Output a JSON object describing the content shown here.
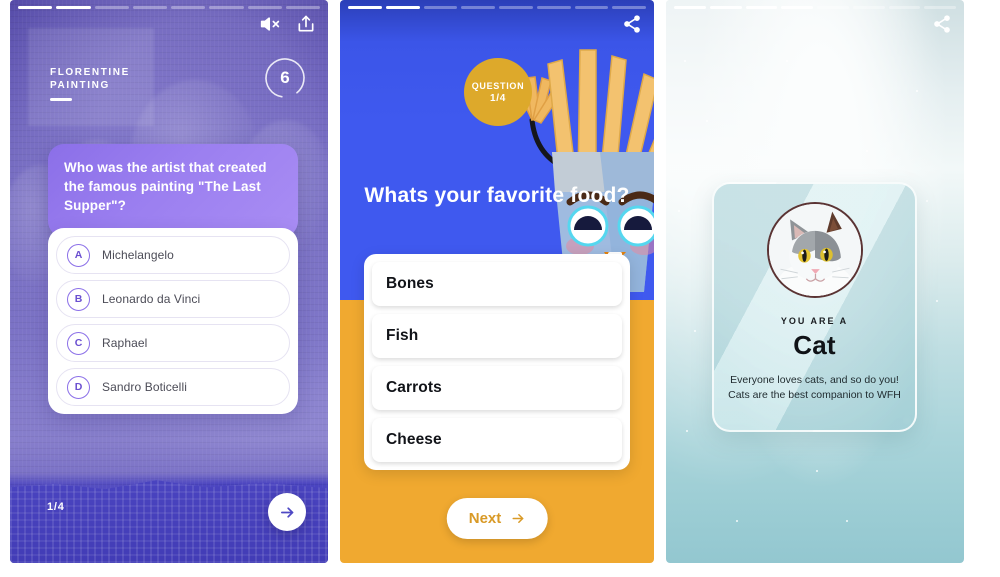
{
  "panels": [
    {
      "name": "quiz-question-purple",
      "progress": {
        "total": 8,
        "filled": 2
      },
      "icons": {
        "mute": "mute-icon",
        "share": "share-ios-icon"
      },
      "category": "FLORENTINE\nPAINTING",
      "category_line1": "FLORENTINE",
      "category_line2": "PAINTING",
      "timer": "6",
      "question": "Who was the artist that created the famous painting \"The Last Supper\"?",
      "answers": [
        {
          "letter": "A",
          "label": "Michelangelo"
        },
        {
          "letter": "B",
          "label": "Leonardo da Vinci"
        },
        {
          "letter": "C",
          "label": "Raphael"
        },
        {
          "letter": "D",
          "label": "Sandro Boticelli"
        }
      ],
      "counter": "1/4",
      "next_icon": "arrow-right-icon",
      "colors": {
        "card": "#9b7ff0",
        "accent": "#4e48c4",
        "bullet": "#8b6fe8"
      }
    },
    {
      "name": "quiz-question-blue-orange",
      "progress": {
        "total": 8,
        "filled": 2
      },
      "icons": {
        "share": "share-nodes-icon"
      },
      "badge_line1": "QUESTION",
      "badge_line2": "1/4",
      "question": "Whats your favorite food?",
      "options": [
        "Bones",
        "Fish",
        "Carrots",
        "Cheese"
      ],
      "next_label": "Next",
      "next_icon": "arrow-right-icon",
      "colors": {
        "top": "#3f59ef",
        "bottom": "#f0a930",
        "badge": "#dda92b",
        "next_text": "#d99a27"
      }
    },
    {
      "name": "quiz-result-cat",
      "progress": {
        "total": 8,
        "filled": 4
      },
      "icons": {
        "share": "share-nodes-icon"
      },
      "eyebrow": "YOU ARE A",
      "title": "Cat",
      "description_line1": "Everyone loves cats, and so do you!",
      "description_line2": "Cats are the best companion to WFH",
      "avatar": "cat-photo",
      "colors": {
        "bg_top": "#f2f8f8",
        "bg_bottom": "#93c7d0",
        "frame": "#5b3434"
      }
    }
  ]
}
